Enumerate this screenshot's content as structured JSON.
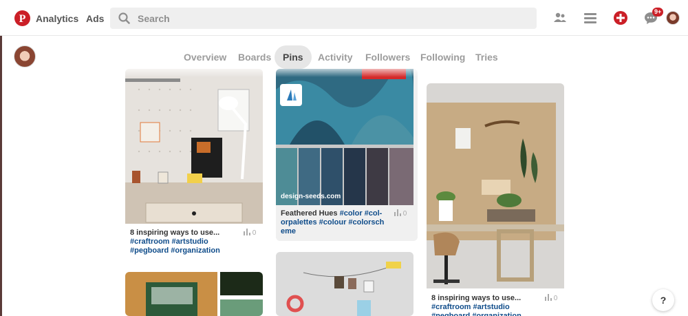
{
  "header": {
    "nav": {
      "analytics": "Analytics",
      "ads": "Ads"
    },
    "search": {
      "placeholder": "Search"
    },
    "notifications_badge": "9+"
  },
  "tabs": [
    {
      "label": "Overview"
    },
    {
      "label": "Boards"
    },
    {
      "label": "Pins",
      "active": true
    },
    {
      "label": "Activity"
    },
    {
      "label": "Followers"
    },
    {
      "label": "Following"
    },
    {
      "label": "Tries"
    }
  ],
  "pins": [
    {
      "desc_prefix": "8 inspiring ways to use... ",
      "desc_tags": "#craftroom #artstudio #pegboard #organization",
      "count": "0"
    },
    {
      "source": "design-seeds.com",
      "desc_prefix": "Feathered Hues ",
      "desc_tags": "#color #col-orpalettes #colour #colorsch eme",
      "count": "0"
    },
    {
      "desc_prefix": "8 inspiring ways to use... ",
      "desc_tags": "#craftroom #artstudio #pegboard #organization",
      "count": "0"
    }
  ],
  "help_label": "?",
  "colors": {
    "brand": "#cb1f27",
    "tag": "#0f4c8a",
    "active_tab_bg": "#e6e6e6"
  }
}
